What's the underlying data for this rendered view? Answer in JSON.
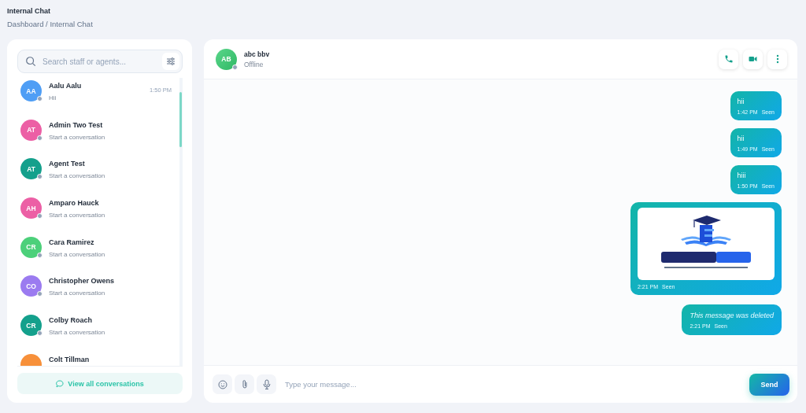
{
  "page": {
    "title": "Internal Chat",
    "breadcrumb": "Dashboard / Internal Chat"
  },
  "sidebar": {
    "search": {
      "placeholder": "Search staff or agents..."
    },
    "contacts": [
      {
        "initials": "AA",
        "name": "Aalu Aalu",
        "preview": "Hii",
        "time": "1:50 PM",
        "color": "#4f9ef5",
        "online": false
      },
      {
        "initials": "AT",
        "name": "Admin Two Test",
        "preview": "Start a conversation",
        "color": "#ec5fa5",
        "online": false
      },
      {
        "initials": "AT",
        "name": "Agent Test",
        "preview": "Start a conversation",
        "color": "#14a08c",
        "online": false
      },
      {
        "initials": "AH",
        "name": "Amparo Hauck",
        "preview": "Start a conversation",
        "color": "#ec5fa5",
        "online": false
      },
      {
        "initials": "CR",
        "name": "Cara Ramirez",
        "preview": "Start a conversation",
        "color": "#4cd07a",
        "online": false
      },
      {
        "initials": "CO",
        "name": "Christopher Owens",
        "preview": "Start a conversation",
        "color": "#9b7bf0",
        "online": false
      },
      {
        "initials": "CR",
        "name": "Colby Roach",
        "preview": "Start a conversation",
        "color": "#14a08c",
        "online": false
      },
      {
        "name": "Colt Tillman",
        "color": "#f7903a"
      }
    ],
    "view_all": "View all conversations"
  },
  "chat": {
    "contact": {
      "initials": "AB",
      "name": "abc bbv",
      "status": "Offline",
      "online": false
    },
    "messages": [
      {
        "kind": "text",
        "text": "hii",
        "time": "1:42 PM",
        "receipt": "Seen"
      },
      {
        "kind": "text",
        "text": "hii",
        "time": "1:49 PM",
        "receipt": "Seen"
      },
      {
        "kind": "text",
        "text": "hiii",
        "time": "1:50 PM",
        "receipt": "Seen"
      },
      {
        "time": "2:21 PM",
        "receipt": "Seen"
      },
      {
        "kind": "deleted",
        "text": "This message was deleted",
        "time": "2:21 PM",
        "receipt": "Seen"
      }
    ],
    "composer": {
      "placeholder": "Type your message...",
      "send": "Send"
    }
  }
}
